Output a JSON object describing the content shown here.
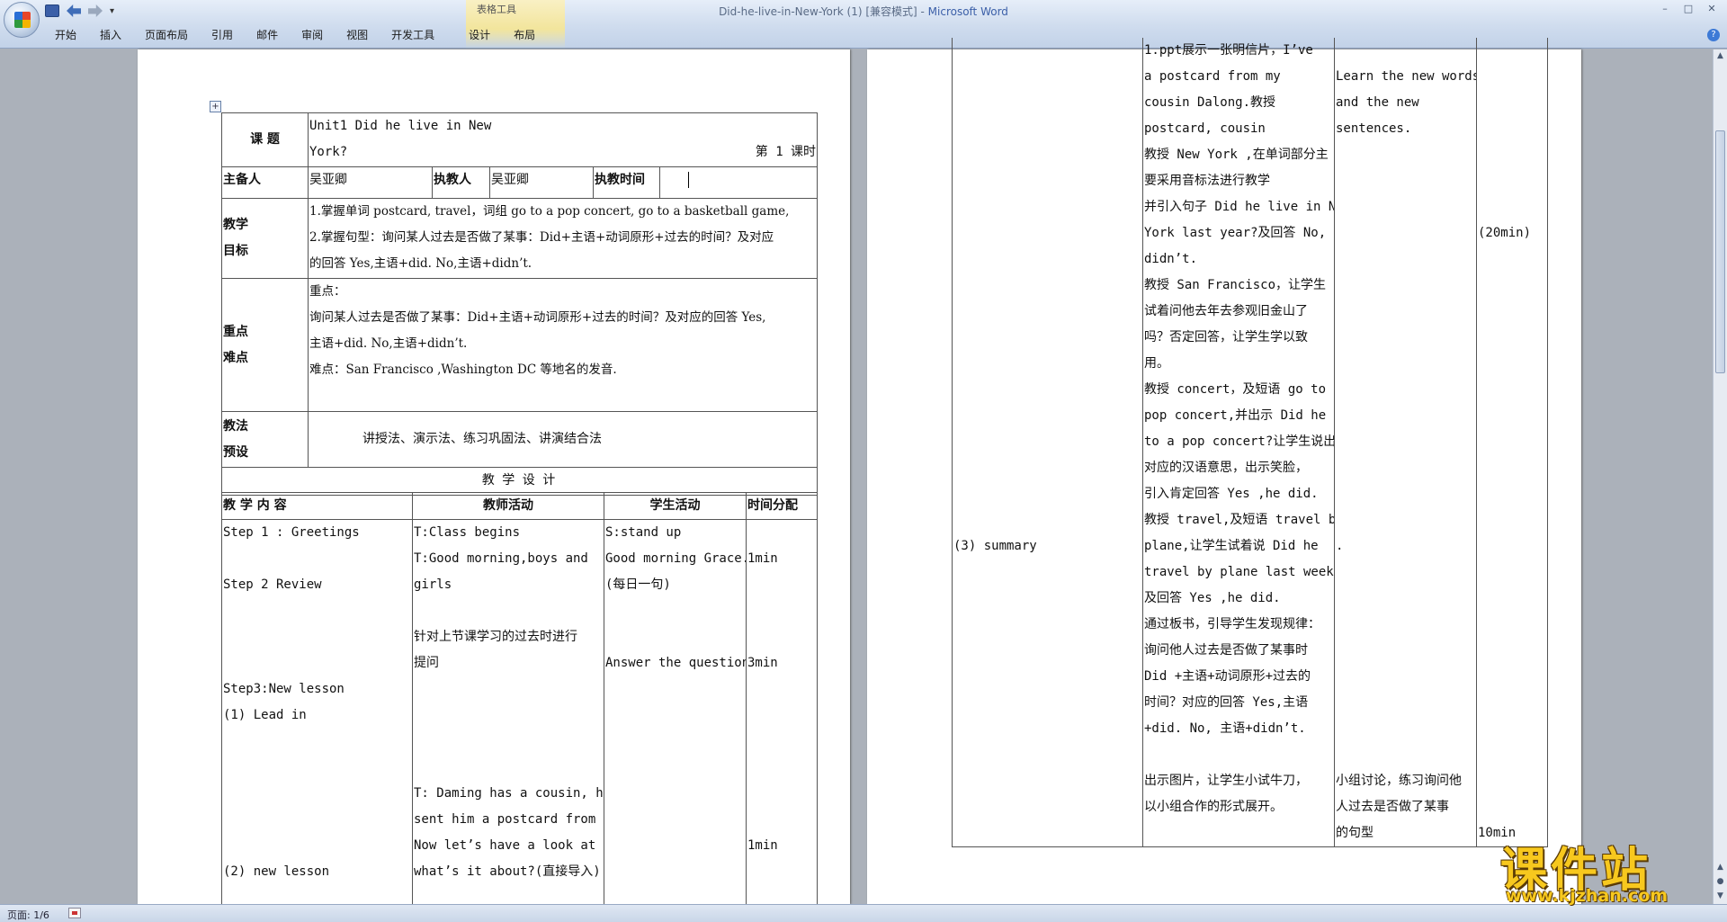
{
  "window": {
    "title_doc": "Did-he-live-in-New-York (1) [兼容模式] - ",
    "title_app": "Microsoft Word",
    "contextual_group": "表格工具",
    "qat_more": "▾",
    "minimize": "–",
    "restore": "□",
    "close": "✕",
    "help": "?"
  },
  "ribbon_tabs": [
    "开始",
    "插入",
    "页面布局",
    "引用",
    "邮件",
    "审阅",
    "视图",
    "开发工具",
    "设计",
    "布局"
  ],
  "status": {
    "page": "页面: 1/6"
  },
  "watermark": {
    "title": "课件站",
    "url": "www.kjzhan.com"
  },
  "left_page": {
    "topic_label": "课  题",
    "topic_line1": "Unit1  Did   he live   in New",
    "topic_line2_a": "York?",
    "topic_line2_b": "第   1   课时",
    "preparer_label": "主备人",
    "preparer": "吴亚卿",
    "teacher_label": "执教人",
    "teacher": "吴亚卿",
    "time_label": "执教时间",
    "goals_label_1": "教学",
    "goals_label_2": "目标",
    "goals_1": "1.掌握单词 postcard, travel，词组 go to a pop concert, go to a basketball game,",
    "goals_2": "2.掌握句型：询问某人过去是否做了某事：Did+主语+动词原形+过去的时间？及对应",
    "goals_3": "的回答 Yes,主语+did. No,主语+didn’t.",
    "key_label_1": "重点",
    "key_label_2": "难点",
    "key_1": "重点：",
    "key_2": "询问某人过去是否做了某事：Did+主语+动词原形+过去的时间？及对应的回答 Yes,",
    "key_3": "主语+did. No,主语+didn’t.",
    "key_4": "难点：San Francisco ,Washington DC 等地名的发音.",
    "method_label_1": "教法",
    "method_label_2": "预设",
    "method": "讲授法、演示法、练习巩固法、讲演结合法",
    "design_header": "教    学    设    计",
    "col_content": "教   学   内   容",
    "col_teacher": "教师活动",
    "col_student": "学生活动",
    "col_time": "时间分配",
    "content_lines": [
      "Step 1 : Greetings",
      "",
      "Step 2 Review",
      "",
      "",
      "",
      "Step3:New lesson",
      "(1)     Lead in",
      "",
      "",
      "",
      "",
      "",
      "(2)     new lesson"
    ],
    "teacher_lines": [
      "T:Class begins",
      "T:Good morning,boys and",
      "girls",
      "",
      "针对上节课学习的过去时进行",
      "提问",
      "",
      "",
      "",
      "",
      "T: Daming has a cousin, he",
      "sent him a postcard from US.",
      "Now let’s have a look at",
      "what’s it about?(直接导入)",
      ""
    ],
    "student_lines": [
      "S:stand up",
      "Good morning Grace.",
      "(每日一句)",
      "",
      "",
      "Answer the questions",
      "",
      "",
      "",
      "",
      "",
      "",
      "",
      "",
      ""
    ],
    "time_lines": [
      "",
      "1min",
      "",
      "",
      "",
      "3min",
      "",
      "",
      "",
      "",
      "",
      "",
      "1min",
      "",
      ""
    ]
  },
  "right_page": {
    "col1_lines": [
      "",
      "",
      "",
      "",
      "",
      "",
      "",
      "",
      "",
      "",
      "",
      "",
      "",
      "",
      "",
      "",
      "",
      "",
      "",
      "(3)     summary",
      "",
      "",
      "",
      "",
      "",
      "",
      "",
      "",
      "",
      ""
    ],
    "col2_lines": [
      "1.ppt展示一张明信片，I’ve",
      "a postcard from my",
      "cousin   Dalong.教授",
      "postcard, cousin",
      "教授 New York ,在单词部分主",
      "要采用音标法进行教学",
      "并引入句子 Did he live in New",
      "York last year?及回答 No, he",
      "didn’t.",
      "教授 San Francisco，让学生",
      "试着问他去年去参观旧金山了",
      "吗？否定回答，让学生学以致",
      "用。",
      "教授 concert，及短语 go to a",
      "pop concert,并出示 Did he go",
      "to a pop concert?让学生说出",
      "对应的汉语意思，出示笑脸，",
      "引入肯定回答 Yes ,he did.",
      "教授 travel,及短语 travel by",
      "plane,让学生试着说 Did he",
      "travel by plane last week?",
      "及回答 Yes ,he did.",
      "通过板书，引导学生发现规律：",
      "询问他人过去是否做了某事时",
      "Did +主语+动词原形+过去的",
      "时间？对应的回答 Yes,主语",
      "+did. No, 主语+didn’t.",
      "",
      "出示图片，让学生小试牛刀，",
      "以小组合作的形式展开。",
      ""
    ],
    "col3_lines": [
      "",
      "Learn the new words",
      "and the new",
      "sentences.",
      "",
      "",
      "",
      "",
      "",
      "",
      "",
      "",
      "",
      "",
      "",
      "",
      "",
      "",
      "",
      ".",
      "",
      "",
      "",
      "",
      "",
      "",
      "",
      "",
      "小组讨论，练习询问他",
      "人过去是否做了某事",
      "的句型"
    ],
    "col4_lines": [
      "",
      "",
      "",
      "",
      "",
      "",
      "",
      "(20min)",
      "",
      "",
      "",
      "",
      "",
      "",
      "",
      "",
      "",
      "",
      "",
      "",
      "",
      "",
      "",
      "",
      "",
      "",
      "",
      "",
      "",
      "",
      "10min"
    ]
  }
}
